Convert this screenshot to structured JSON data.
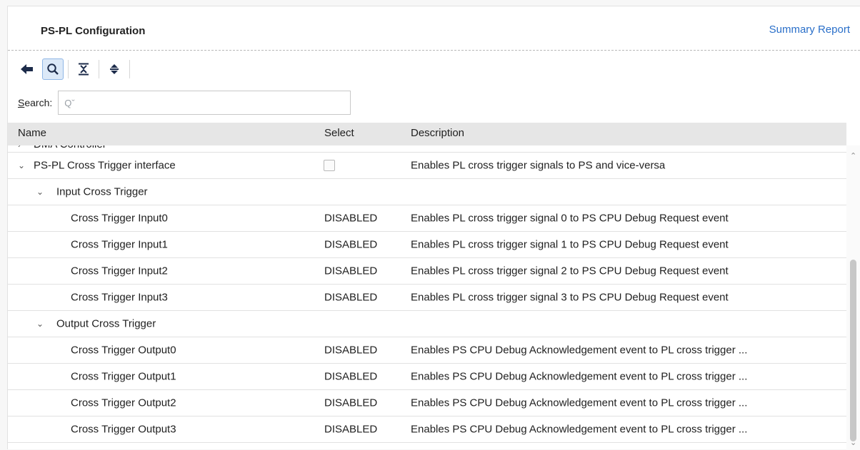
{
  "header": {
    "title": "PS-PL Configuration",
    "summary_link": "Summary Report"
  },
  "toolbar": {
    "icons": [
      "back-arrow-icon",
      "search-icon",
      "collapse-all-icon",
      "expand-all-icon"
    ]
  },
  "search": {
    "label_underlined": "S",
    "label_rest": "earch:",
    "placeholder": "Qˇ"
  },
  "table": {
    "columns": {
      "name": "Name",
      "select": "Select",
      "description": "Description"
    },
    "rows": [
      {
        "name": "DMA Controller",
        "select": "",
        "description": "",
        "expander": "›"
      },
      {
        "name": "PS-PL Cross Trigger interface",
        "select": "",
        "description": "Enables PL cross trigger signals to PS and vice-versa",
        "expander": "⌄"
      },
      {
        "name": "Input Cross Trigger",
        "select": "",
        "description": "",
        "expander": "⌄"
      },
      {
        "name": "Cross Trigger Input0",
        "select": "DISABLED",
        "description": "Enables PL cross trigger signal 0 to PS CPU Debug Request event"
      },
      {
        "name": "Cross Trigger Input1",
        "select": "DISABLED",
        "description": "Enables PL cross trigger signal 1 to PS CPU Debug Request event"
      },
      {
        "name": "Cross Trigger Input2",
        "select": "DISABLED",
        "description": "Enables PL cross trigger signal 2 to PS CPU Debug Request event"
      },
      {
        "name": "Cross Trigger Input3",
        "select": "DISABLED",
        "description": "Enables PL cross trigger signal 3 to PS CPU Debug Request event"
      },
      {
        "name": "Output Cross Trigger",
        "select": "",
        "description": "",
        "expander": "⌄"
      },
      {
        "name": "Cross Trigger Output0",
        "select": "DISABLED",
        "description": "Enables PS CPU Debug Acknowledgement event to PL cross trigger ..."
      },
      {
        "name": "Cross Trigger Output1",
        "select": "DISABLED",
        "description": "Enables PS CPU Debug Acknowledgement event to PL cross trigger ..."
      },
      {
        "name": "Cross Trigger Output2",
        "select": "DISABLED",
        "description": "Enables PS CPU Debug Acknowledgement event to PL cross trigger ..."
      },
      {
        "name": "Cross Trigger Output3",
        "select": "DISABLED",
        "description": "Enables PS CPU Debug Acknowledgement event to PL cross trigger ..."
      }
    ]
  },
  "colors": {
    "link": "#2a6fc9",
    "header_bg": "#e6e6e6",
    "active_tool": "#dce9f8"
  }
}
